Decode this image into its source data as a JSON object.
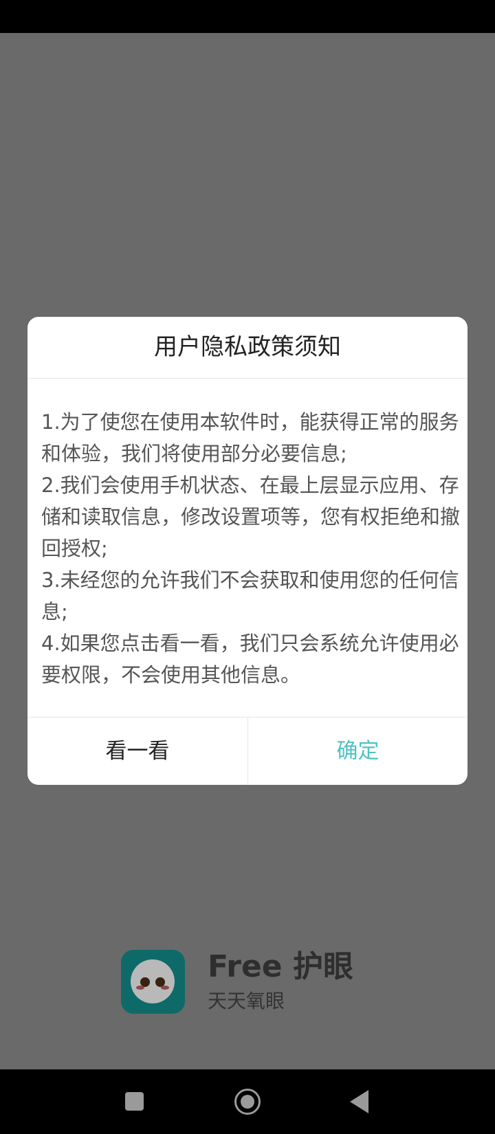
{
  "dialog": {
    "title": "用户隐私政策须知",
    "paragraphs": [
      "1.为了使您在使用本软件时，能获得正常的服务和体验，我们将使用部分必要信息;",
      "2.我们会使用手机状态、在最上层显示应用、存储和读取信息，修改设置项等，您有权拒绝和撤回授权;",
      "3.未经您的允许我们不会获取和使用您的任何信息;",
      "4.如果您点击看一看，我们只会系统允许使用必要权限，不会使用其他信息。"
    ],
    "buttons": {
      "look_label": "看一看",
      "confirm_label": "确定"
    },
    "colors": {
      "confirm": "#4fc3c3"
    }
  },
  "brand": {
    "name": "Free 护眼",
    "subtitle": "天天氧眼",
    "icon": "cartoon-face-icon"
  },
  "nav": {
    "recents_icon": "square-icon",
    "home_icon": "circle-icon",
    "back_icon": "triangle-back-icon"
  }
}
